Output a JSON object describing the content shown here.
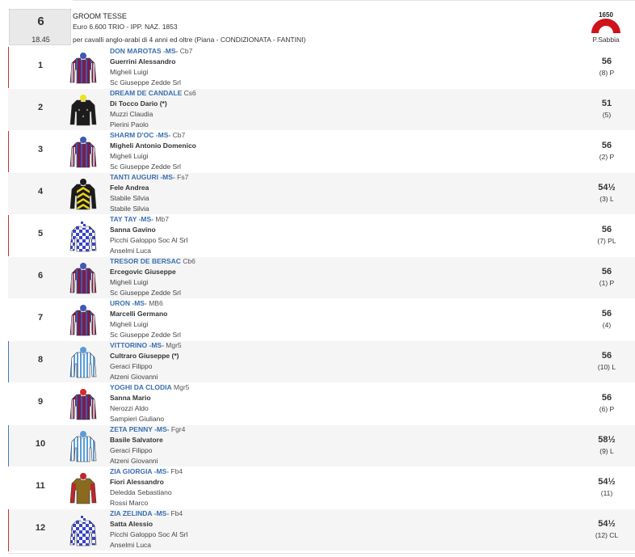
{
  "race": {
    "number": "6",
    "time": "18.45",
    "name": "GROOM TESSE",
    "info": "Euro 6.600 TRIO - IPP. NAZ. 1853",
    "conditions": "per cavalli anglo-arabi di 4 anni ed oltre (Piana -  CONDIZIONATA  - FANTINI)",
    "distance": "1650",
    "track": "P.Sabbia",
    "track_color": "#d0121a"
  },
  "accents": {
    "red": "#c9302c",
    "blue": "#3a78c2",
    "none": "transparent"
  },
  "runners": [
    {
      "num": "1",
      "horse": "DON MAROTAS -MS-",
      "extra": "Cb7",
      "jockey": "Guerrini Alessandro",
      "trainer": "Migheli Luigi",
      "owner": "Sc Giuseppe Zedde Srl",
      "weight": "56",
      "draw": "(8) P",
      "silk": "maroon-stripes",
      "accent": "red"
    },
    {
      "num": "2",
      "horse": "DREAM DE CANDALE",
      "extra": "Cs6",
      "jockey": "Di Tocco Dario (*)",
      "trainer": "Muzzi Claudia",
      "owner": "Pierini Paolo",
      "weight": "51",
      "draw": "(5)",
      "silk": "black-yellow-cap",
      "accent": "none"
    },
    {
      "num": "3",
      "horse": "SHARM D'OC -MS-",
      "extra": "Cb7",
      "jockey": "Migheli Antonio Domenico",
      "trainer": "Migheli Luigi",
      "owner": "Sc Giuseppe Zedde Srl",
      "weight": "56",
      "draw": "(2) P",
      "silk": "maroon-stripes",
      "accent": "red"
    },
    {
      "num": "4",
      "horse": "TANTI AUGURI -MS-",
      "extra": "Fs7",
      "jockey": "Fele Andrea",
      "trainer": "Stabile Silvia",
      "owner": "Stabile Silvia",
      "weight": "54½",
      "draw": "(3) L",
      "silk": "black-yellow-chevrons",
      "accent": "none"
    },
    {
      "num": "5",
      "horse": "TAY TAY -MS-",
      "extra": "Mb7",
      "jockey": "Sanna Gavino",
      "trainer": "Picchi Galoppo Soc Al Srl",
      "owner": "Anselmi Luca",
      "weight": "56",
      "draw": "(7) PL",
      "silk": "blue-check",
      "accent": "red"
    },
    {
      "num": "6",
      "horse": "TRESOR DE BERSAC",
      "extra": "Cb6",
      "jockey": "Ercegovic Giuseppe",
      "trainer": "Migheli Luigi",
      "owner": "Sc Giuseppe Zedde Srl",
      "weight": "56",
      "draw": "(1) P",
      "silk": "maroon-stripes",
      "accent": "none"
    },
    {
      "num": "7",
      "horse": "URON -MS-",
      "extra": "MB6",
      "jockey": "Marcelli Germano",
      "trainer": "Migheli Luigi",
      "owner": "Sc Giuseppe Zedde Srl",
      "weight": "56",
      "draw": "(4)",
      "silk": "maroon-stripes",
      "accent": "none"
    },
    {
      "num": "8",
      "horse": "VITTORINO -MS-",
      "extra": "Mgr5",
      "jockey": "Cultraro Giuseppe (*)",
      "trainer": "Geraci Filippo",
      "owner": "Atzeni Giovanni",
      "weight": "56",
      "draw": "(10) L",
      "silk": "lightblue-stripes",
      "accent": "blue"
    },
    {
      "num": "9",
      "horse": "YOGHI DA CLODIA",
      "extra": "Mgr5",
      "jockey": "Sanna Mario",
      "trainer": "Nerozzi Aldo",
      "owner": "Sampieri Giuliano",
      "weight": "56",
      "draw": "(6) P",
      "silk": "maroon-stripes-red-cap",
      "accent": "none"
    },
    {
      "num": "10",
      "horse": "ZETA PENNY -MS-",
      "extra": "Fgr4",
      "jockey": "Basile Salvatore",
      "trainer": "Geraci Filippo",
      "owner": "Atzeni Giovanni",
      "weight": "58½",
      "draw": "(9) L",
      "silk": "lightblue-stripes",
      "accent": "blue"
    },
    {
      "num": "11",
      "horse": "ZIA GIORGIA -MS-",
      "extra": "Fb4",
      "jockey": "Fiori Alessandro",
      "trainer": "Deledda Sebastiano",
      "owner": "Rossi Marco",
      "weight": "54½",
      "draw": "(11)",
      "silk": "olive-red",
      "accent": "none"
    },
    {
      "num": "12",
      "horse": "ZIA ZELINDA -MS-",
      "extra": "Fb4",
      "jockey": "Satta Alessio",
      "trainer": "Picchi Galoppo Soc Al Srl",
      "owner": "Anselmi Luca",
      "weight": "54½",
      "draw": "(12) CL",
      "silk": "blue-check",
      "accent": "red"
    }
  ]
}
